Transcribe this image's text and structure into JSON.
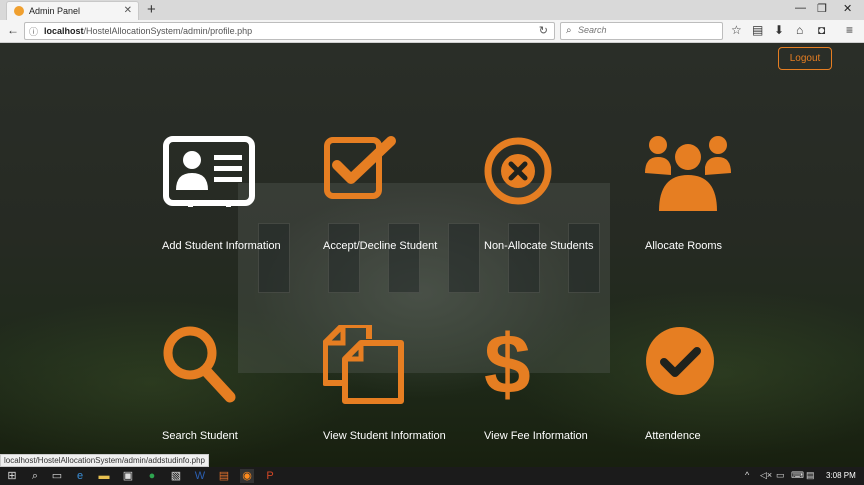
{
  "browser": {
    "tab_title": "Admin Panel",
    "url_host": "localhost",
    "url_path": "/HostelAllocationSystem/admin/profile.php",
    "search_placeholder": "Search"
  },
  "header": {
    "logout_label": "Logout"
  },
  "tiles": [
    {
      "label": "Add Student Information",
      "icon": "id-card-icon",
      "color": "#ffffff"
    },
    {
      "label": "Accept/Decline Student",
      "icon": "check-square-icon",
      "color": "#e67e22"
    },
    {
      "label": "Non-Allocate Students",
      "icon": "times-circle-icon",
      "color": "#e67e22"
    },
    {
      "label": "Allocate Rooms",
      "icon": "users-icon",
      "color": "#e67e22"
    },
    {
      "label": "Search Student",
      "icon": "search-icon",
      "color": "#e67e22"
    },
    {
      "label": "View Student Information",
      "icon": "files-icon",
      "color": "#e67e22"
    },
    {
      "label": "View Fee Information",
      "icon": "dollar-icon",
      "color": "#e67e22"
    },
    {
      "label": "Attendence",
      "icon": "check-circle-icon",
      "color": "#e67e22"
    }
  ],
  "status_link": "localhost/HostelAllocationSystem/admin/addstudinfo.php",
  "taskbar": {
    "clock": "3:08 PM"
  },
  "theme": {
    "accent": "#e67e22"
  }
}
